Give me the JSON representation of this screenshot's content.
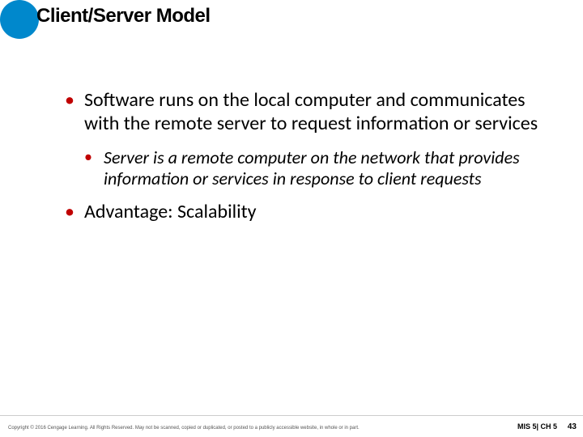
{
  "title": "Client/Server Model",
  "bullets": {
    "main1": "Software runs on the local computer and communicates with the remote server to request information or services",
    "sub1": "Server is a remote computer on the network that provides information or services in response to client requests",
    "main2": "Advantage: Scalability"
  },
  "footer": {
    "copyright": "Copyright © 2016 Cengage Learning. All Rights Reserved. May not be scanned, copied or duplicated, or posted to a publicly accessible website, in whole or in part.",
    "chapter": "MIS 5| CH 5",
    "page": "43"
  }
}
